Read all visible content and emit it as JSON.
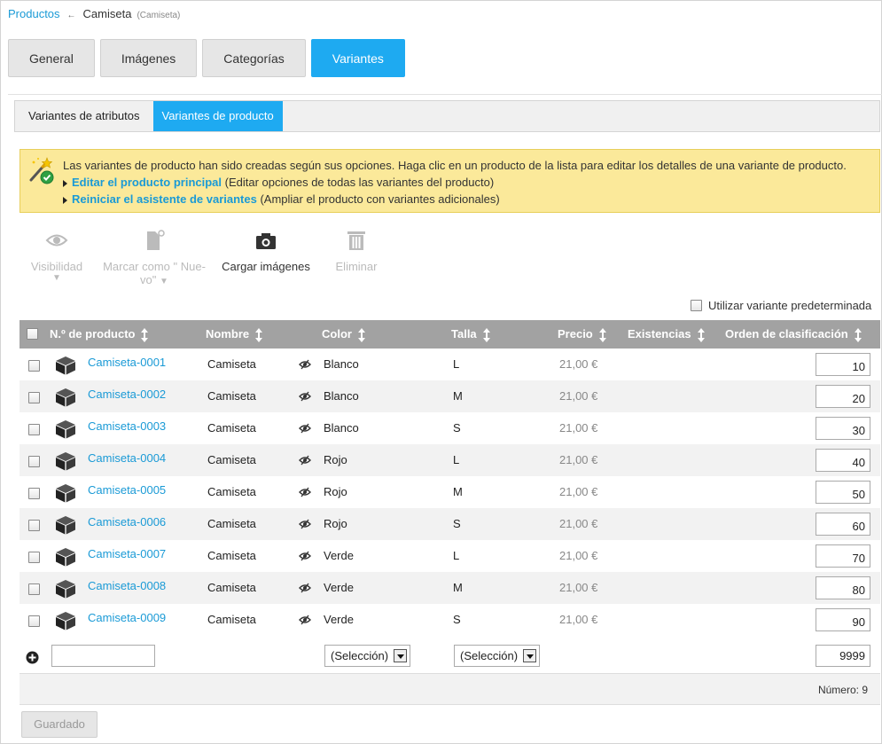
{
  "breadcrumb": {
    "parent": "Productos",
    "current": "Camiseta",
    "current_sub": "(Camiseta)"
  },
  "main_tabs": [
    {
      "label": "General",
      "active": false
    },
    {
      "label": "Imágenes",
      "active": false
    },
    {
      "label": "Categorías",
      "active": false
    },
    {
      "label": "Variantes",
      "active": true
    }
  ],
  "sub_tabs": [
    {
      "label": "Variantes de atributos",
      "active": false
    },
    {
      "label": "Variantes de producto",
      "active": true
    }
  ],
  "info": {
    "text": "Las variantes de producto han sido creadas según sus opciones. Haga clic en un producto de la lista para editar los detalles de una variante de producto.",
    "link1": "Editar el producto principal",
    "link1_note": " (Editar opciones de todas las variantes del producto)",
    "link2": "Reiniciar el asistente de variantes",
    "link2_note": " (Ampliar el producto con variantes adicionales)"
  },
  "toolbar": {
    "visibility": "Visibilidad",
    "mark_new_1": "Marcar como \" Nue-",
    "mark_new_2": "vo\"",
    "upload_images": "Cargar imágenes",
    "delete": "Eliminar"
  },
  "default_variant_label": "Utilizar variante predeterminada",
  "table": {
    "headers": {
      "product_no": "N.º de producto",
      "name": "Nombre",
      "color": "Color",
      "size": "Talla",
      "price": "Precio",
      "stock": "Existencias",
      "sort_order": "Orden de clasificación"
    },
    "rows": [
      {
        "product_no": "Camiseta-0001",
        "name": "Camiseta",
        "color": "Blanco",
        "size": "L",
        "price": "21,00 €",
        "sort_order": "10"
      },
      {
        "product_no": "Camiseta-0002",
        "name": "Camiseta",
        "color": "Blanco",
        "size": "M",
        "price": "21,00 €",
        "sort_order": "20"
      },
      {
        "product_no": "Camiseta-0003",
        "name": "Camiseta",
        "color": "Blanco",
        "size": "S",
        "price": "21,00 €",
        "sort_order": "30"
      },
      {
        "product_no": "Camiseta-0004",
        "name": "Camiseta",
        "color": "Rojo",
        "size": "L",
        "price": "21,00 €",
        "sort_order": "40"
      },
      {
        "product_no": "Camiseta-0005",
        "name": "Camiseta",
        "color": "Rojo",
        "size": "M",
        "price": "21,00 €",
        "sort_order": "50"
      },
      {
        "product_no": "Camiseta-0006",
        "name": "Camiseta",
        "color": "Rojo",
        "size": "S",
        "price": "21,00 €",
        "sort_order": "60"
      },
      {
        "product_no": "Camiseta-0007",
        "name": "Camiseta",
        "color": "Verde",
        "size": "L",
        "price": "21,00 €",
        "sort_order": "70"
      },
      {
        "product_no": "Camiseta-0008",
        "name": "Camiseta",
        "color": "Verde",
        "size": "M",
        "price": "21,00 €",
        "sort_order": "80"
      },
      {
        "product_no": "Camiseta-0009",
        "name": "Camiseta",
        "color": "Verde",
        "size": "S",
        "price": "21,00 €",
        "sort_order": "90"
      }
    ]
  },
  "new_row": {
    "color_select": "(Selección)",
    "size_select": "(Selección)",
    "sort_order": "9999"
  },
  "count_text": "Número: 9",
  "save_label": "Guardado",
  "colors": {
    "accent": "#1eaaf1",
    "link": "#1a9ad6",
    "info_bg": "#fbe99a",
    "header_bg": "#a2a2a2"
  }
}
